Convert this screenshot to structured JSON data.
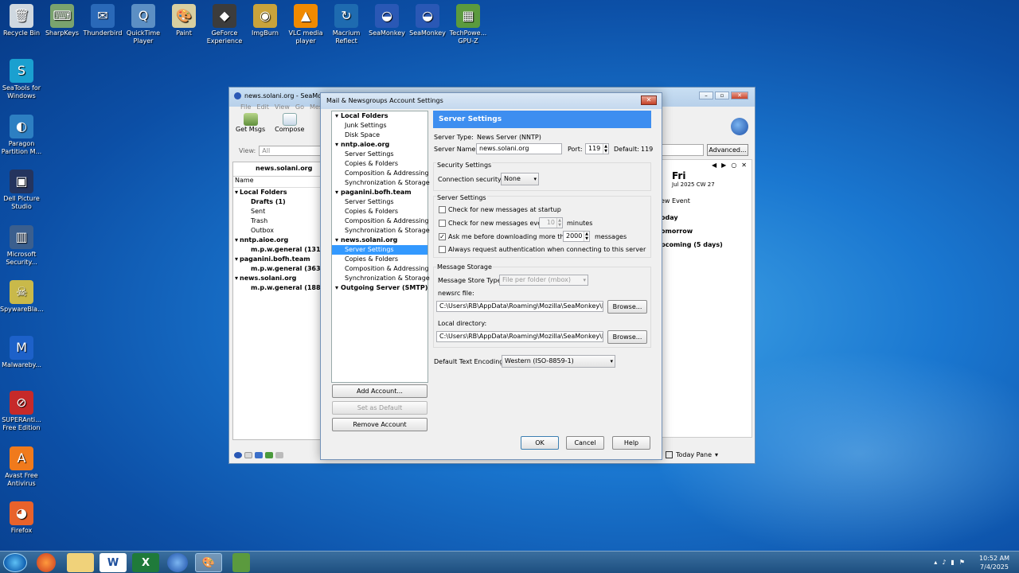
{
  "desktop": {
    "top_icons": [
      {
        "label": "Recycle Bin",
        "color": "#cfd8e0",
        "glyph": "🗑"
      },
      {
        "label": "SharpKeys",
        "color": "#7aa36e",
        "glyph": "⌨"
      },
      {
        "label": "Thunderbird",
        "color": "#2a69b8",
        "glyph": "✉"
      },
      {
        "label": "QuickTime Player",
        "color": "#5c8fc4",
        "glyph": "Q"
      },
      {
        "label": "Paint",
        "color": "#d8cfa0",
        "glyph": "🎨"
      },
      {
        "label": "GeForce Experience",
        "color": "#3c3c3c",
        "glyph": "◆"
      },
      {
        "label": "ImgBurn",
        "color": "#c9a33b",
        "glyph": "◉"
      },
      {
        "label": "VLC media player",
        "color": "#f08a00",
        "glyph": "▲"
      },
      {
        "label": "Macrium Reflect",
        "color": "#1e6bb0",
        "glyph": "↻"
      },
      {
        "label": "SeaMonkey",
        "color": "#2a58b5",
        "glyph": "◒"
      },
      {
        "label": "SeaMonkey",
        "color": "#2a58b5",
        "glyph": "◒"
      },
      {
        "label": "TechPowe... GPU-Z",
        "color": "#5b9a3e",
        "glyph": "▦"
      }
    ],
    "left_icons": [
      {
        "label": "SeaTools for Windows",
        "color": "#1aa0d0",
        "glyph": "S"
      },
      {
        "label": "Paragon Partition M...",
        "color": "#2d7fc2",
        "glyph": "◐"
      },
      {
        "label": "Dell Picture Studio",
        "color": "#24345e",
        "glyph": "▣"
      },
      {
        "label": "Microsoft Security...",
        "color": "#3b5f8e",
        "glyph": "▥"
      },
      {
        "label": "SpywareBla...",
        "color": "#c9b94a",
        "glyph": "☠"
      },
      {
        "label": "Malwareby...",
        "color": "#1d61c9",
        "glyph": "M"
      },
      {
        "label": "SUPERAnti... Free Edition",
        "color": "#c62a2a",
        "glyph": "⊘"
      },
      {
        "label": "Avast Free Antivirus",
        "color": "#f07a1c",
        "glyph": "A"
      },
      {
        "label": "Firefox",
        "color": "#e8622b",
        "glyph": "◕"
      }
    ]
  },
  "main_window": {
    "title": "news.solani.org - SeaMonkey",
    "menu": [
      "File",
      "Edit",
      "View",
      "Go",
      "Mess"
    ],
    "toolbar": {
      "get_msgs": "Get Msgs",
      "compose": "Compose"
    },
    "view_label": "View:",
    "view_value": "All",
    "folder_header": "news.solani.org",
    "name_column": "Name",
    "folders": [
      {
        "text": "Local Folders",
        "indent": 0,
        "bold": true
      },
      {
        "text": "Drafts (1)",
        "indent": 1,
        "bold": true
      },
      {
        "text": "Sent",
        "indent": 1,
        "bold": false
      },
      {
        "text": "Trash",
        "indent": 1,
        "bold": false
      },
      {
        "text": "Outbox",
        "indent": 1,
        "bold": false
      },
      {
        "text": "nntp.aioe.org",
        "indent": 0,
        "bold": true
      },
      {
        "text": "m.p.w.general (1310",
        "indent": 1,
        "bold": true
      },
      {
        "text": "paganini.bofh.team",
        "indent": 0,
        "bold": true
      },
      {
        "text": "m.p.w.general (3632",
        "indent": 1,
        "bold": true
      },
      {
        "text": "news.solani.org",
        "indent": 0,
        "bold": true
      },
      {
        "text": "m.p.w.general (1885",
        "indent": 1,
        "bold": true
      }
    ],
    "advanced_button": "Advanced...",
    "calendar": {
      "day": "Fri",
      "date": "Jul 2025  CW 27",
      "new_event": "ew Event",
      "today": "oday",
      "tomorrow": "omorrow",
      "upcoming": "pcoming (5 days)"
    },
    "today_pane": "Today Pane"
  },
  "dialog": {
    "title": "Mail & Newsgroups Account Settings",
    "tree": [
      {
        "text": "Local Folders",
        "type": "acct"
      },
      {
        "text": "Junk Settings",
        "type": "item"
      },
      {
        "text": "Disk Space",
        "type": "item"
      },
      {
        "text": "nntp.aioe.org",
        "type": "acct"
      },
      {
        "text": "Server Settings",
        "type": "item"
      },
      {
        "text": "Copies & Folders",
        "type": "item"
      },
      {
        "text": "Composition & Addressing",
        "type": "item"
      },
      {
        "text": "Synchronization & Storage",
        "type": "item"
      },
      {
        "text": "paganini.bofh.team",
        "type": "acct"
      },
      {
        "text": "Server Settings",
        "type": "item"
      },
      {
        "text": "Copies & Folders",
        "type": "item"
      },
      {
        "text": "Composition & Addressing",
        "type": "item"
      },
      {
        "text": "Synchronization & Storage",
        "type": "item"
      },
      {
        "text": "news.solani.org",
        "type": "acct"
      },
      {
        "text": "Server Settings",
        "type": "sel"
      },
      {
        "text": "Copies & Folders",
        "type": "item"
      },
      {
        "text": "Composition & Addressing",
        "type": "item"
      },
      {
        "text": "Synchronization & Storage",
        "type": "item"
      },
      {
        "text": "Outgoing Server (SMTP)",
        "type": "acct"
      }
    ],
    "add_account": "Add Account...",
    "set_default": "Set as Default",
    "remove_account": "Remove Account",
    "panel_title": "Server Settings",
    "server_type_label": "Server Type:",
    "server_type_value": "News Server (NNTP)",
    "server_name_label": "Server Name:",
    "server_name_value": "news.solani.org",
    "port_label": "Port:",
    "port_value": "119",
    "default_label": "Default:",
    "default_value": "119",
    "security_header": "Security Settings",
    "conn_security_label": "Connection security:",
    "conn_security_value": "None",
    "server_settings_header": "Server Settings",
    "check_startup": "Check for new messages at startup",
    "check_every": "Check for new messages every",
    "check_every_value": "10",
    "minutes": "minutes",
    "ask_before": "Ask me before downloading more than",
    "ask_value": "2000",
    "messages": "messages",
    "always_auth": "Always request authentication when connecting to this server",
    "storage_header": "Message Storage",
    "store_type_label": "Message Store Type:",
    "store_type_value": "File per folder (mbox)",
    "newsrc_label": "newsrc file:",
    "newsrc_value": "C:\\Users\\RB\\AppData\\Roaming\\Mozilla\\SeaMonkey\\Profi",
    "browse": "Browse...",
    "local_dir_label": "Local directory:",
    "local_dir_value": "C:\\Users\\RB\\AppData\\Roaming\\Mozilla\\SeaMonkey\\Profi",
    "encoding_label": "Default Text Encoding:",
    "encoding_value": "Western (ISO-8859-1)",
    "ok": "OK",
    "cancel": "Cancel",
    "help": "Help"
  },
  "taskbar": {
    "time": "10:52 AM",
    "date": "7/4/2025"
  }
}
